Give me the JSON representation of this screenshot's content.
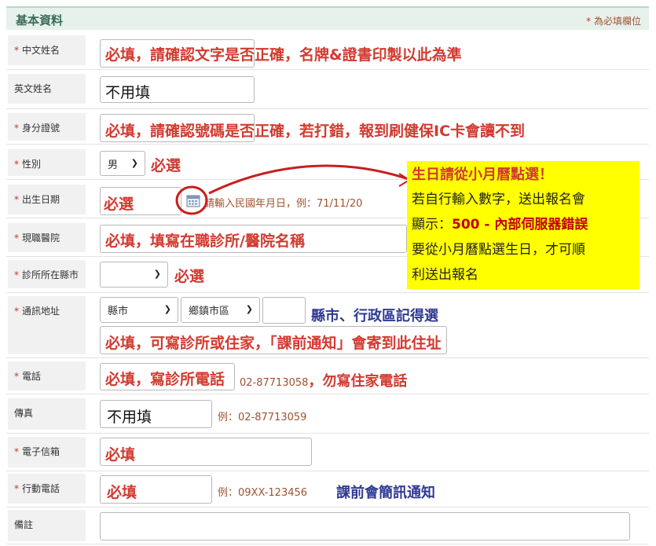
{
  "header": {
    "title": "基本資料",
    "required_note": "為必填欄位",
    "required_mark": "*"
  },
  "rows": {
    "chinese_name": {
      "label": "中文姓名",
      "note": "必填，請確認文字是否正確，名牌&證書印製以此為準"
    },
    "english_name": {
      "label": "英文姓名",
      "value": "不用填"
    },
    "id_number": {
      "label": "身分證號",
      "note": "必填，請確認號碼是否正確，若打錯，報到刷健保IC卡會讀不到"
    },
    "gender": {
      "label": "性別",
      "selected": "男",
      "note": "必選"
    },
    "birthdate": {
      "label": "出生日期",
      "value": "必選",
      "hint": "請輸入民國年月日，例：71/11/20"
    },
    "hospital": {
      "label": "現職醫院",
      "note": "必填，填寫在職診所/醫院名稱"
    },
    "clinic_county": {
      "label": "診所所在縣市",
      "selected": "",
      "note": "必選"
    },
    "address": {
      "label": "通訊地址",
      "county_selected": "縣市",
      "district_selected": "鄉鎮市區",
      "note_district": "縣市、行政區記得選",
      "note_address": "必填，可寫診所或住家，「課前通知」會寄到此住址"
    },
    "phone": {
      "label": "電話",
      "note": "必填，寫診所電話",
      "hint": "02-87713058",
      "warn": "，勿寫住家電話"
    },
    "fax": {
      "label": "傳真",
      "value": "不用填",
      "hint": "例：02-87713059"
    },
    "email": {
      "label": "電子信箱",
      "value": "必填"
    },
    "mobile": {
      "label": "行動電話",
      "value": "必填",
      "hint": "例：09XX-123456",
      "note": "課前會簡訊通知"
    },
    "remarks": {
      "label": "備註"
    }
  },
  "callout": {
    "title": "生日請從小月曆點選！",
    "line1": "若自行輸入數字，送出報名會",
    "line2_prefix": "顯示：",
    "line2_error": "500 - 內部伺服器錯誤",
    "line3": "要從小月曆點選生日，才可順",
    "line4": "利送出報名"
  },
  "colors": {
    "header_bg": "#e6f1ec",
    "accent_red": "#d23a30",
    "accent_blue": "#2f3a94",
    "callout_bg": "#ffff00"
  },
  "icons": {
    "calendar": "calendar-icon",
    "select": "chevron-down-icon"
  }
}
